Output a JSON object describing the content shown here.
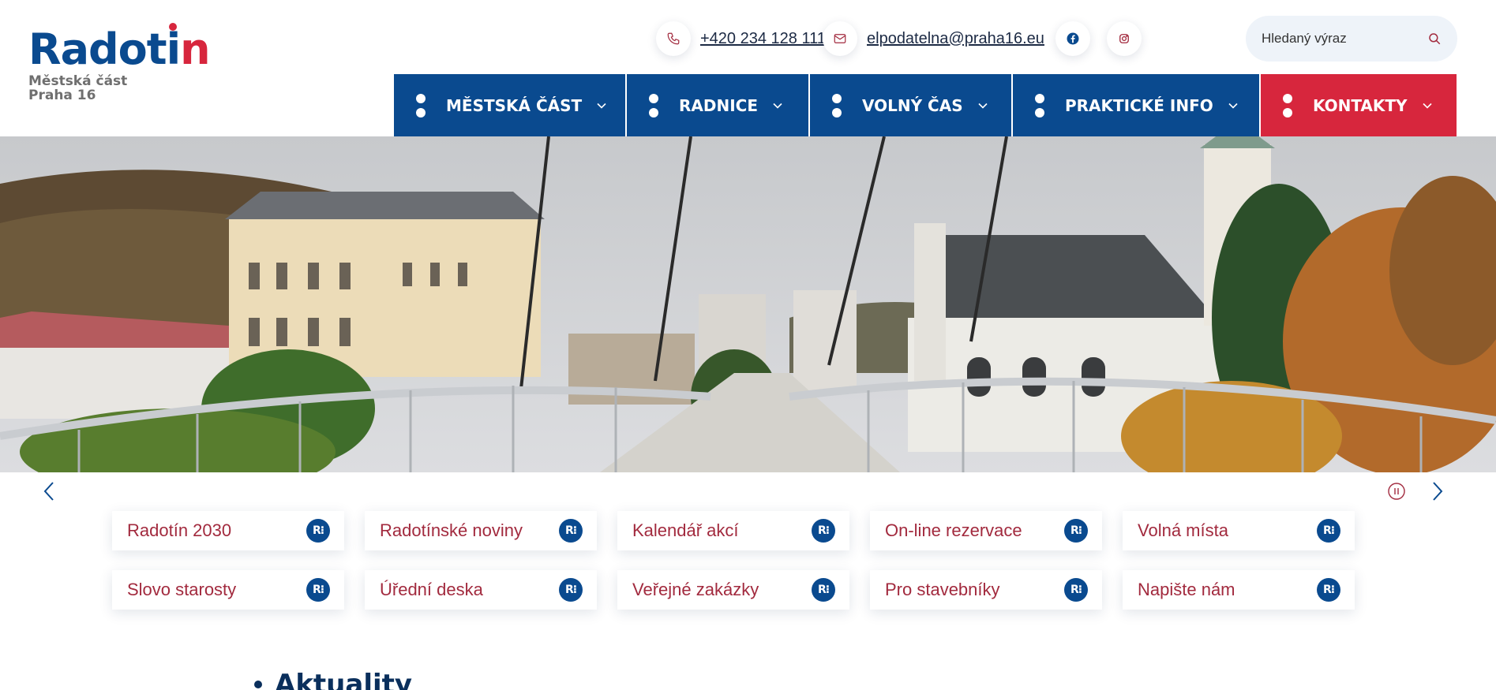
{
  "logo": {
    "wordmark_main": "Radoti",
    "wordmark_last": "n",
    "subtitle_line1": "Městská část",
    "subtitle_line2": "Praha 16"
  },
  "contact": {
    "phone": "+420 234 128 111",
    "email": "elpodatelna@praha16.eu",
    "phone_icon": "phone-icon",
    "email_icon": "mail-icon",
    "facebook_icon": "facebook-icon",
    "instagram_icon": "instagram-icon"
  },
  "search": {
    "placeholder": "Hledaný výraz",
    "icon": "search-icon"
  },
  "nav": {
    "items": [
      {
        "label": "MĚSTSKÁ ČÁST"
      },
      {
        "label": "RADNICE"
      },
      {
        "label": "VOLNÝ ČAS"
      },
      {
        "label": "PRAKTICKÉ INFO"
      },
      {
        "label": "KONTAKTY"
      }
    ]
  },
  "slider": {
    "prev_icon": "chevron-left-icon",
    "pause_icon": "pause-icon",
    "next_icon": "chevron-right-icon"
  },
  "quick_links": {
    "badge": "R⁝",
    "row1": [
      {
        "label": "Radotín 2030"
      },
      {
        "label": "Radotínské noviny"
      },
      {
        "label": "Kalendář akcí"
      },
      {
        "label": "On-line rezervace"
      },
      {
        "label": "Volná místa"
      }
    ],
    "row2": [
      {
        "label": "Slovo starosty"
      },
      {
        "label": "Úřední deska"
      },
      {
        "label": "Veřejné zakázky"
      },
      {
        "label": "Pro stavebníky"
      },
      {
        "label": "Napište nám"
      }
    ]
  },
  "section": {
    "title": "Aktuality"
  },
  "colors": {
    "brand_blue": "#0a4a8f",
    "brand_red": "#d7263d",
    "link_red": "#a22a3e"
  }
}
